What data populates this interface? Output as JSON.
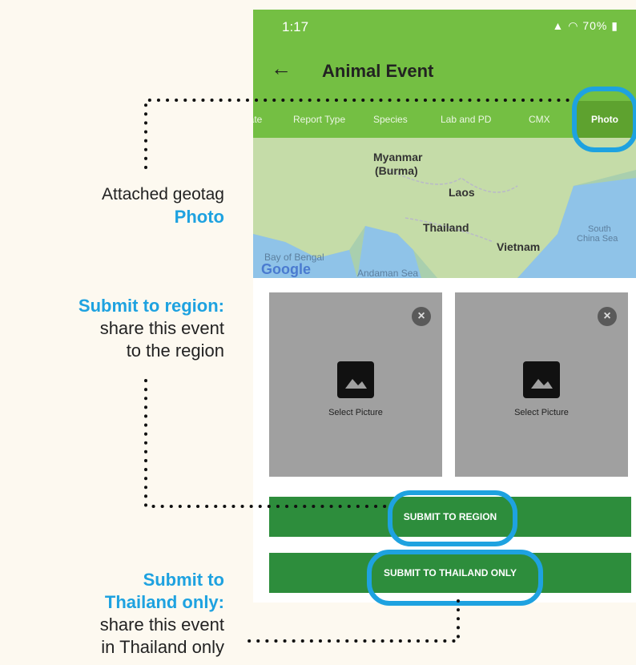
{
  "status_bar": {
    "time": "1:17",
    "battery": "70%"
  },
  "app_bar": {
    "back_icon": "arrow-left-icon",
    "title": "Animal Event"
  },
  "tabs": [
    {
      "label": "Date"
    },
    {
      "label": "Report Type"
    },
    {
      "label": "Species"
    },
    {
      "label": "Lab and PD"
    },
    {
      "label": "CMX"
    },
    {
      "label": "Photo",
      "active": true
    }
  ],
  "map": {
    "labels": [
      "Myanmar",
      "(Burma)",
      "Laos",
      "Thailand",
      "Vietnam",
      "South",
      "China Sea",
      "Bay of Bengal",
      "Andaman Sea"
    ],
    "logo": "Google"
  },
  "pictures": [
    {
      "label": "Select Picture"
    },
    {
      "label": "Select Picture"
    }
  ],
  "buttons": {
    "submit_region": "SUBMIT TO REGION",
    "submit_thailand": "SUBMIT TO THAILAND ONLY"
  },
  "annotations": {
    "geotag_line1": "Attached geotag",
    "geotag_line2": "Photo",
    "region_title": "Submit to region:",
    "region_line1": "share this event",
    "region_line2": "to the region",
    "thailand_title1": "Submit to",
    "thailand_title2": "Thailand only:",
    "thailand_line1": "share this event",
    "thailand_line2": "in Thailand only"
  },
  "colors": {
    "app_green": "#74bf43",
    "button_green": "#2d8d3c",
    "accent_blue": "#1ea2e0"
  }
}
